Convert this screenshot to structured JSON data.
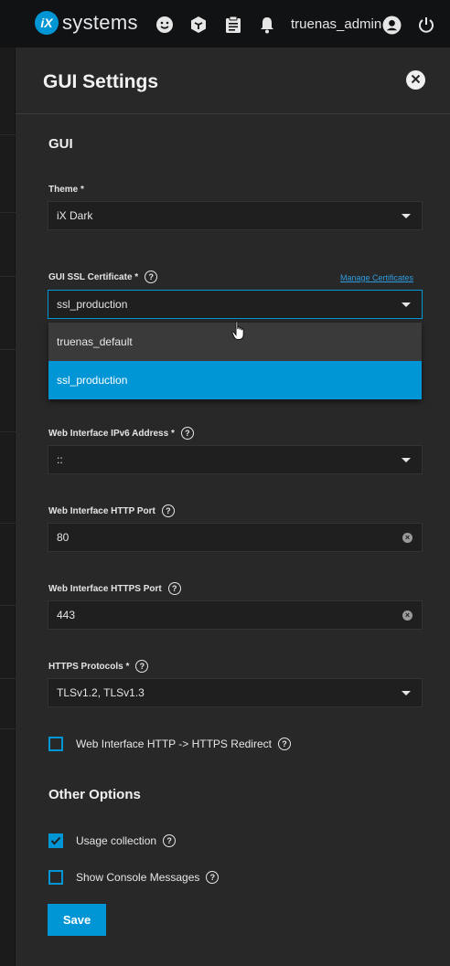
{
  "topbar": {
    "logo_mark": "iX",
    "logo_word": "systems",
    "icons": [
      "feedback-icon",
      "truecommand-icon",
      "task-manager-icon",
      "notifications-icon",
      "account-icon",
      "power-icon"
    ],
    "user_name": "truenas_admin"
  },
  "panel": {
    "title": "GUI Settings",
    "sections": {
      "gui": "GUI",
      "other": "Other Options"
    },
    "theme": {
      "label": "Theme *",
      "value": "iX Dark"
    },
    "ssl": {
      "label": "GUI SSL Certificate *",
      "value": "ssl_production",
      "manage_link": "Manage Certificates",
      "options": [
        "truenas_default",
        "ssl_production"
      ],
      "selected_index": 1
    },
    "ipv6": {
      "label": "Web Interface IPv6 Address *",
      "value": "::"
    },
    "http_port": {
      "label": "Web Interface HTTP Port",
      "value": "80"
    },
    "https_port": {
      "label": "Web Interface HTTPS Port",
      "value": "443"
    },
    "protocols": {
      "label": "HTTPS Protocols *",
      "value": "TLSv1.2, TLSv1.3"
    },
    "redirect": {
      "label": "Web Interface HTTP -> HTTPS Redirect",
      "checked": false
    },
    "usage": {
      "label": "Usage collection",
      "checked": true
    },
    "console": {
      "label": "Show Console Messages",
      "checked": false
    },
    "save_label": "Save",
    "help_glyph": "?"
  },
  "colors": {
    "accent": "#0095d5",
    "panel_bg": "#282828",
    "topbar_bg": "#111214"
  }
}
